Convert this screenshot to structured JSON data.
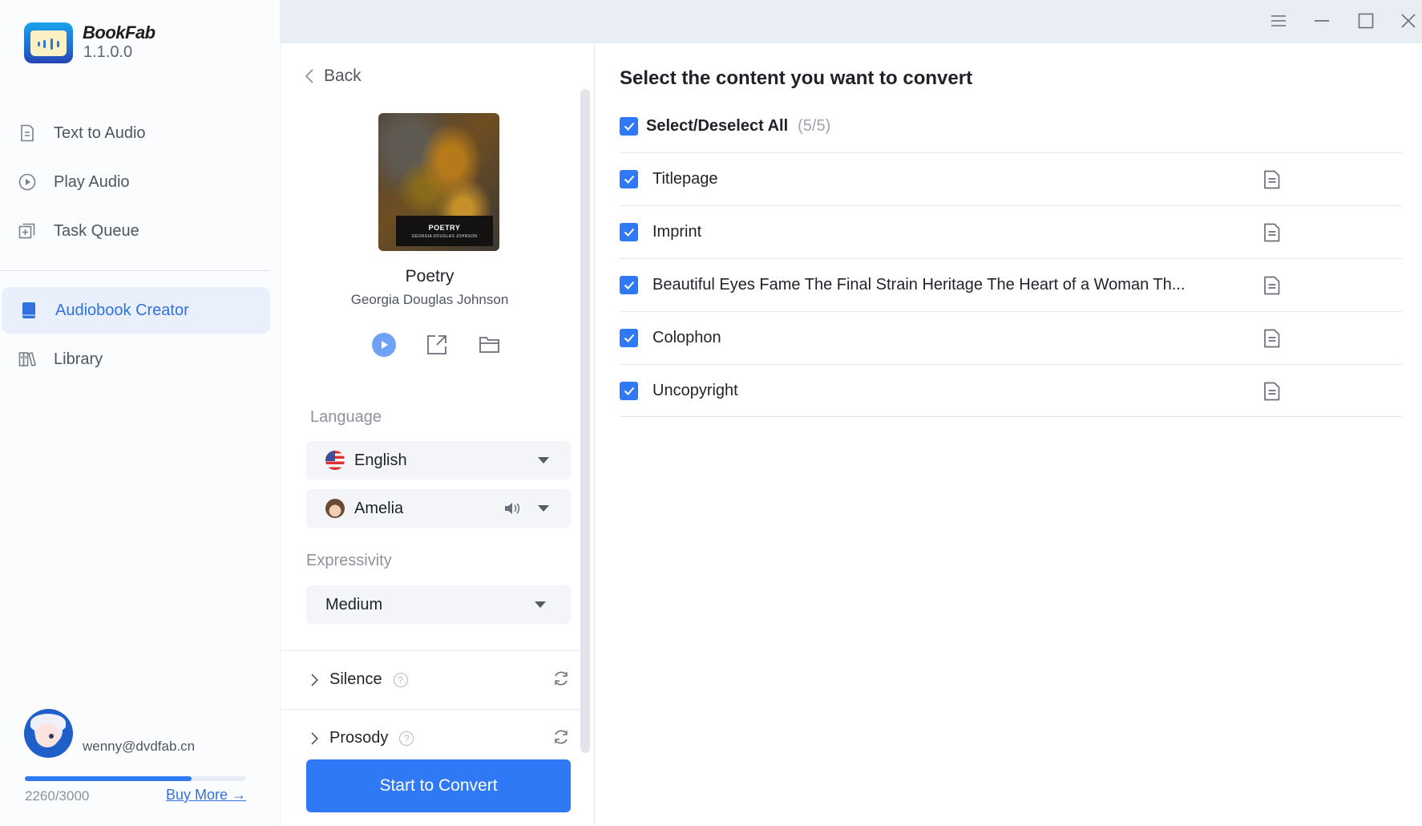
{
  "app": {
    "name": "BookFab",
    "version": "1.1.0.0"
  },
  "sidebar": {
    "items": [
      {
        "label": "Text to Audio",
        "icon": "document-icon",
        "active": false
      },
      {
        "label": "Play Audio",
        "icon": "play-circle-icon",
        "active": false
      },
      {
        "label": "Task Queue",
        "icon": "task-queue-icon",
        "active": false
      },
      {
        "label": "Audiobook Creator",
        "icon": "book-icon",
        "active": true
      },
      {
        "label": "Library",
        "icon": "library-icon",
        "active": false
      }
    ],
    "user": {
      "email": "wenny@dvdfab.cn",
      "quota_text": "2260/3000",
      "quota_used": 2260,
      "quota_total": 3000,
      "buy_more_label": "Buy More →"
    }
  },
  "window_controls": [
    "menu-icon",
    "minimize-icon",
    "maximize-icon",
    "close-icon"
  ],
  "panel": {
    "back_label": "Back",
    "book": {
      "cover_title": "POETRY",
      "cover_author": "GEORGIA DOUGLAS JOHNSON",
      "title": "Poetry",
      "author": "Georgia Douglas Johnson"
    },
    "language_label": "Language",
    "language_value": "English",
    "voice_value": "Amelia",
    "expressivity_label": "Expressivity",
    "expressivity_value": "Medium",
    "silence_label": "Silence",
    "prosody_label": "Prosody",
    "convert_label": "Start to Convert"
  },
  "content": {
    "heading": "Select the content you want to convert",
    "select_all_label": "Select/Deselect All",
    "select_count": "(5/5)",
    "chapters": [
      {
        "title": "Titlepage",
        "checked": true
      },
      {
        "title": "Imprint",
        "checked": true
      },
      {
        "title": "Beautiful Eyes Fame The Final Strain Heritage The Heart of a Woman Th...",
        "checked": true
      },
      {
        "title": "Colophon",
        "checked": true
      },
      {
        "title": "Uncopyright",
        "checked": true
      }
    ]
  },
  "colors": {
    "accent": "#3079f6",
    "active_nav_bg": "#e9f0fb",
    "titlebar_bg": "#e9edf4"
  }
}
